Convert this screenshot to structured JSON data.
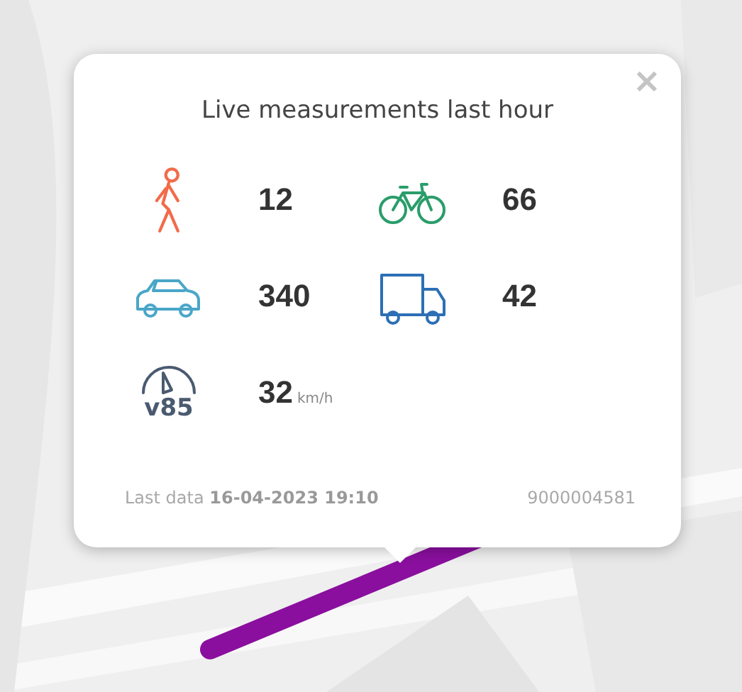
{
  "popup": {
    "title": "Live measurements last hour",
    "close": "×",
    "measurements": [
      {
        "kind": "pedestrian",
        "value": "12"
      },
      {
        "kind": "bicycle",
        "value": "66"
      },
      {
        "kind": "car",
        "value": "340"
      },
      {
        "kind": "truck",
        "value": "42"
      },
      {
        "kind": "speed",
        "label": "v85",
        "value": "32",
        "unit": "km/h"
      }
    ],
    "last_data": "Last data **16-04-2023 19:10**",
    "sensor_id": "9000004581"
  }
}
